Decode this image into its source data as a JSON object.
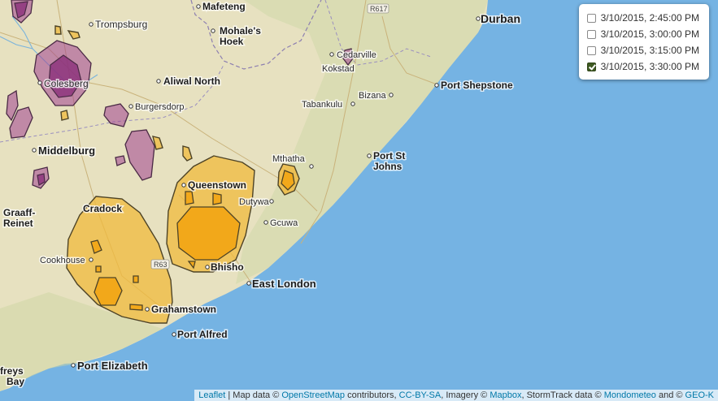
{
  "layer_control": {
    "options": [
      {
        "label": "3/10/2015, 2:45:00 PM",
        "checked": false
      },
      {
        "label": "3/10/2015, 3:00:00 PM",
        "checked": false
      },
      {
        "label": "3/10/2015, 3:15:00 PM",
        "checked": false
      },
      {
        "label": "3/10/2015, 3:30:00 PM",
        "checked": true
      }
    ]
  },
  "places": [
    {
      "id": "durban",
      "name": "Durban",
      "major": true
    },
    {
      "id": "mafeteng",
      "name": "Mafeteng",
      "major": true
    },
    {
      "id": "mohales-hoek-1",
      "name": "Mohale's",
      "major": true
    },
    {
      "id": "mohales-hoek-2",
      "name": "Hoek",
      "major": true
    },
    {
      "id": "trompsburg",
      "name": "Trompsburg",
      "major": false
    },
    {
      "id": "colesberg",
      "name": "Colesberg",
      "major": false
    },
    {
      "id": "aliwal-north",
      "name": "Aliwal North",
      "major": true
    },
    {
      "id": "cedarville",
      "name": "Cedarville",
      "major": false
    },
    {
      "id": "kokstad",
      "name": "Kokstad",
      "major": false
    },
    {
      "id": "port-shepstone",
      "name": "Port Shepstone",
      "major": true
    },
    {
      "id": "burgersdorp",
      "name": "Burgersdorp",
      "major": false
    },
    {
      "id": "tabankulu",
      "name": "Tabankulu",
      "major": false
    },
    {
      "id": "bizana",
      "name": "Bizana",
      "major": false
    },
    {
      "id": "middelburg",
      "name": "Middelburg",
      "major": true
    },
    {
      "id": "mthatha",
      "name": "Mthatha",
      "major": false
    },
    {
      "id": "port-st-johns-1",
      "name": "Port St",
      "major": true
    },
    {
      "id": "port-st-johns-2",
      "name": "Johns",
      "major": true
    },
    {
      "id": "queenstown",
      "name": "Queenstown",
      "major": true
    },
    {
      "id": "dutywa",
      "name": "Dutywa",
      "major": false
    },
    {
      "id": "graaff-reinet-1",
      "name": "Graaff-",
      "major": true
    },
    {
      "id": "graaff-reinet-2",
      "name": "Reinet",
      "major": true
    },
    {
      "id": "cradock",
      "name": "Cradock",
      "major": true
    },
    {
      "id": "gcuwa",
      "name": "Gcuwa",
      "major": false
    },
    {
      "id": "cookhouse",
      "name": "Cookhouse",
      "major": false
    },
    {
      "id": "bhisho",
      "name": "Bhisho",
      "major": true
    },
    {
      "id": "east-london",
      "name": "East London",
      "major": true
    },
    {
      "id": "grahamstown",
      "name": "Grahamstown",
      "major": true
    },
    {
      "id": "port-alfred",
      "name": "Port Alfred",
      "major": true
    },
    {
      "id": "port-elizabeth",
      "name": "Port Elizabeth",
      "major": true
    },
    {
      "id": "jeffreys-bay-1",
      "name": "freys",
      "major": true
    },
    {
      "id": "jeffreys-bay-2",
      "name": "Bay",
      "major": true
    }
  ],
  "road_shields": [
    "R617",
    "R63"
  ],
  "colors": {
    "ocean": "#75b3e3",
    "land": "#e8e2c2",
    "storm_low": "#f0b93c",
    "storm_high": "#f2a81a",
    "hail": "#a0428f",
    "storm_outline": "#4d4326"
  },
  "attribution": {
    "leaflet": "Leaflet",
    "sep1": " | Map data © ",
    "osm": "OpenStreetMap",
    "sep2": " contributors, ",
    "license": "CC-BY-SA",
    "sep3": ", Imagery © ",
    "mapbox": "Mapbox",
    "sep4": ", StormTrack data © ",
    "mondometeo": "Mondometeo",
    "sep5": " and © ",
    "geok": "GEO-K"
  }
}
